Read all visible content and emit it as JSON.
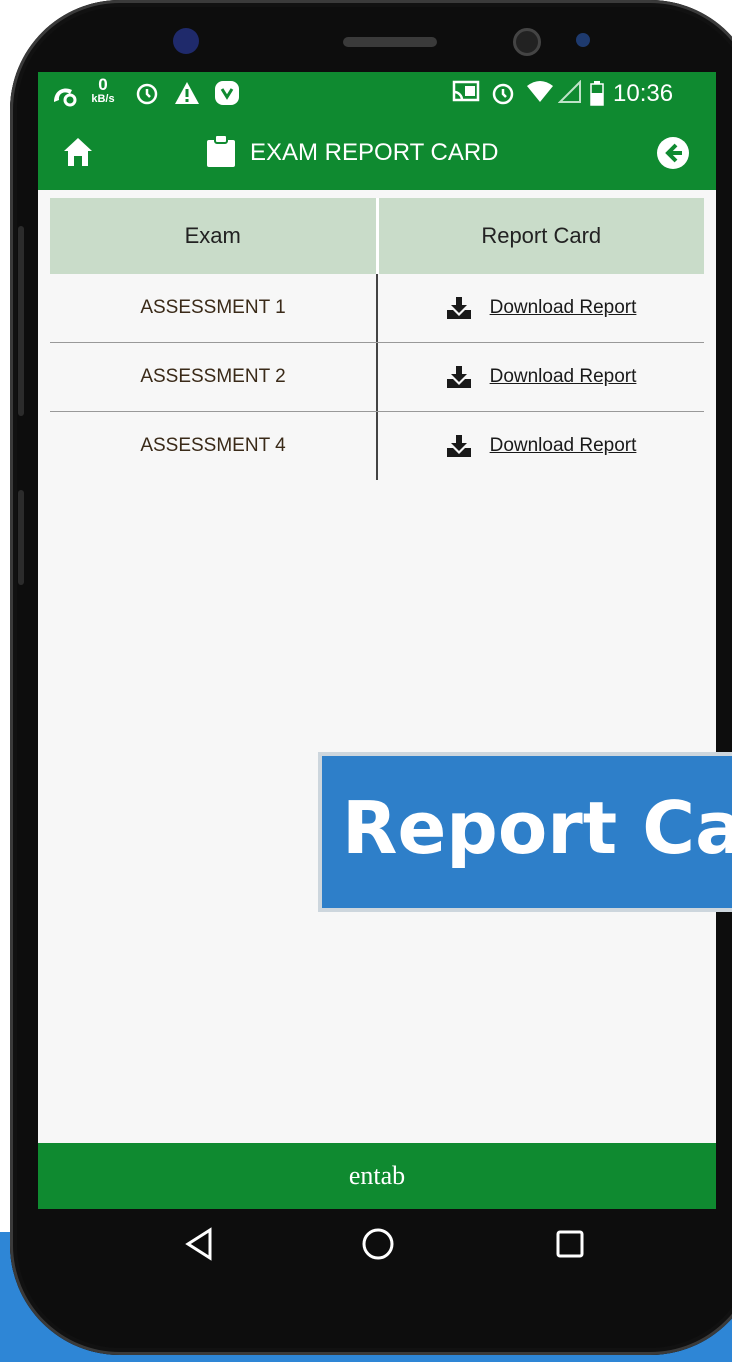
{
  "status_bar": {
    "data_speed_value": "0",
    "data_speed_unit": "kB/s",
    "time": "10:36",
    "left_icons": [
      "uc-browser-icon",
      "alarm-icon",
      "warning-icon",
      "app-notification-icon"
    ],
    "right_icons": [
      "cast-icon",
      "alarm-icon",
      "wifi-icon",
      "signal-icon",
      "battery-icon"
    ]
  },
  "app_bar": {
    "title": "EXAM REPORT CARD",
    "home_icon": "home-icon",
    "title_icon": "clipboard-icon",
    "back_icon": "back-arrow-icon"
  },
  "table": {
    "headers": [
      "Exam",
      "Report Card"
    ],
    "rows": [
      {
        "exam": "ASSESSMENT 1",
        "action": "Download Report"
      },
      {
        "exam": "ASSESSMENT 2",
        "action": "Download Report"
      },
      {
        "exam": "ASSESSMENT 4",
        "action": "Download Report"
      }
    ]
  },
  "footer": {
    "brand": "entab"
  },
  "nav_bar": {
    "icons": [
      "back-triangle-icon",
      "home-circle-icon",
      "recents-square-icon"
    ]
  },
  "overlay_banner": {
    "text": "Report Ca"
  },
  "colors": {
    "primary_green": "#0f8a30",
    "header_row": "#c9dcc9",
    "overlay_blue": "#2e7fc9",
    "bottom_strip_blue": "#2e86d6",
    "bezel": "#0d0d0d"
  }
}
